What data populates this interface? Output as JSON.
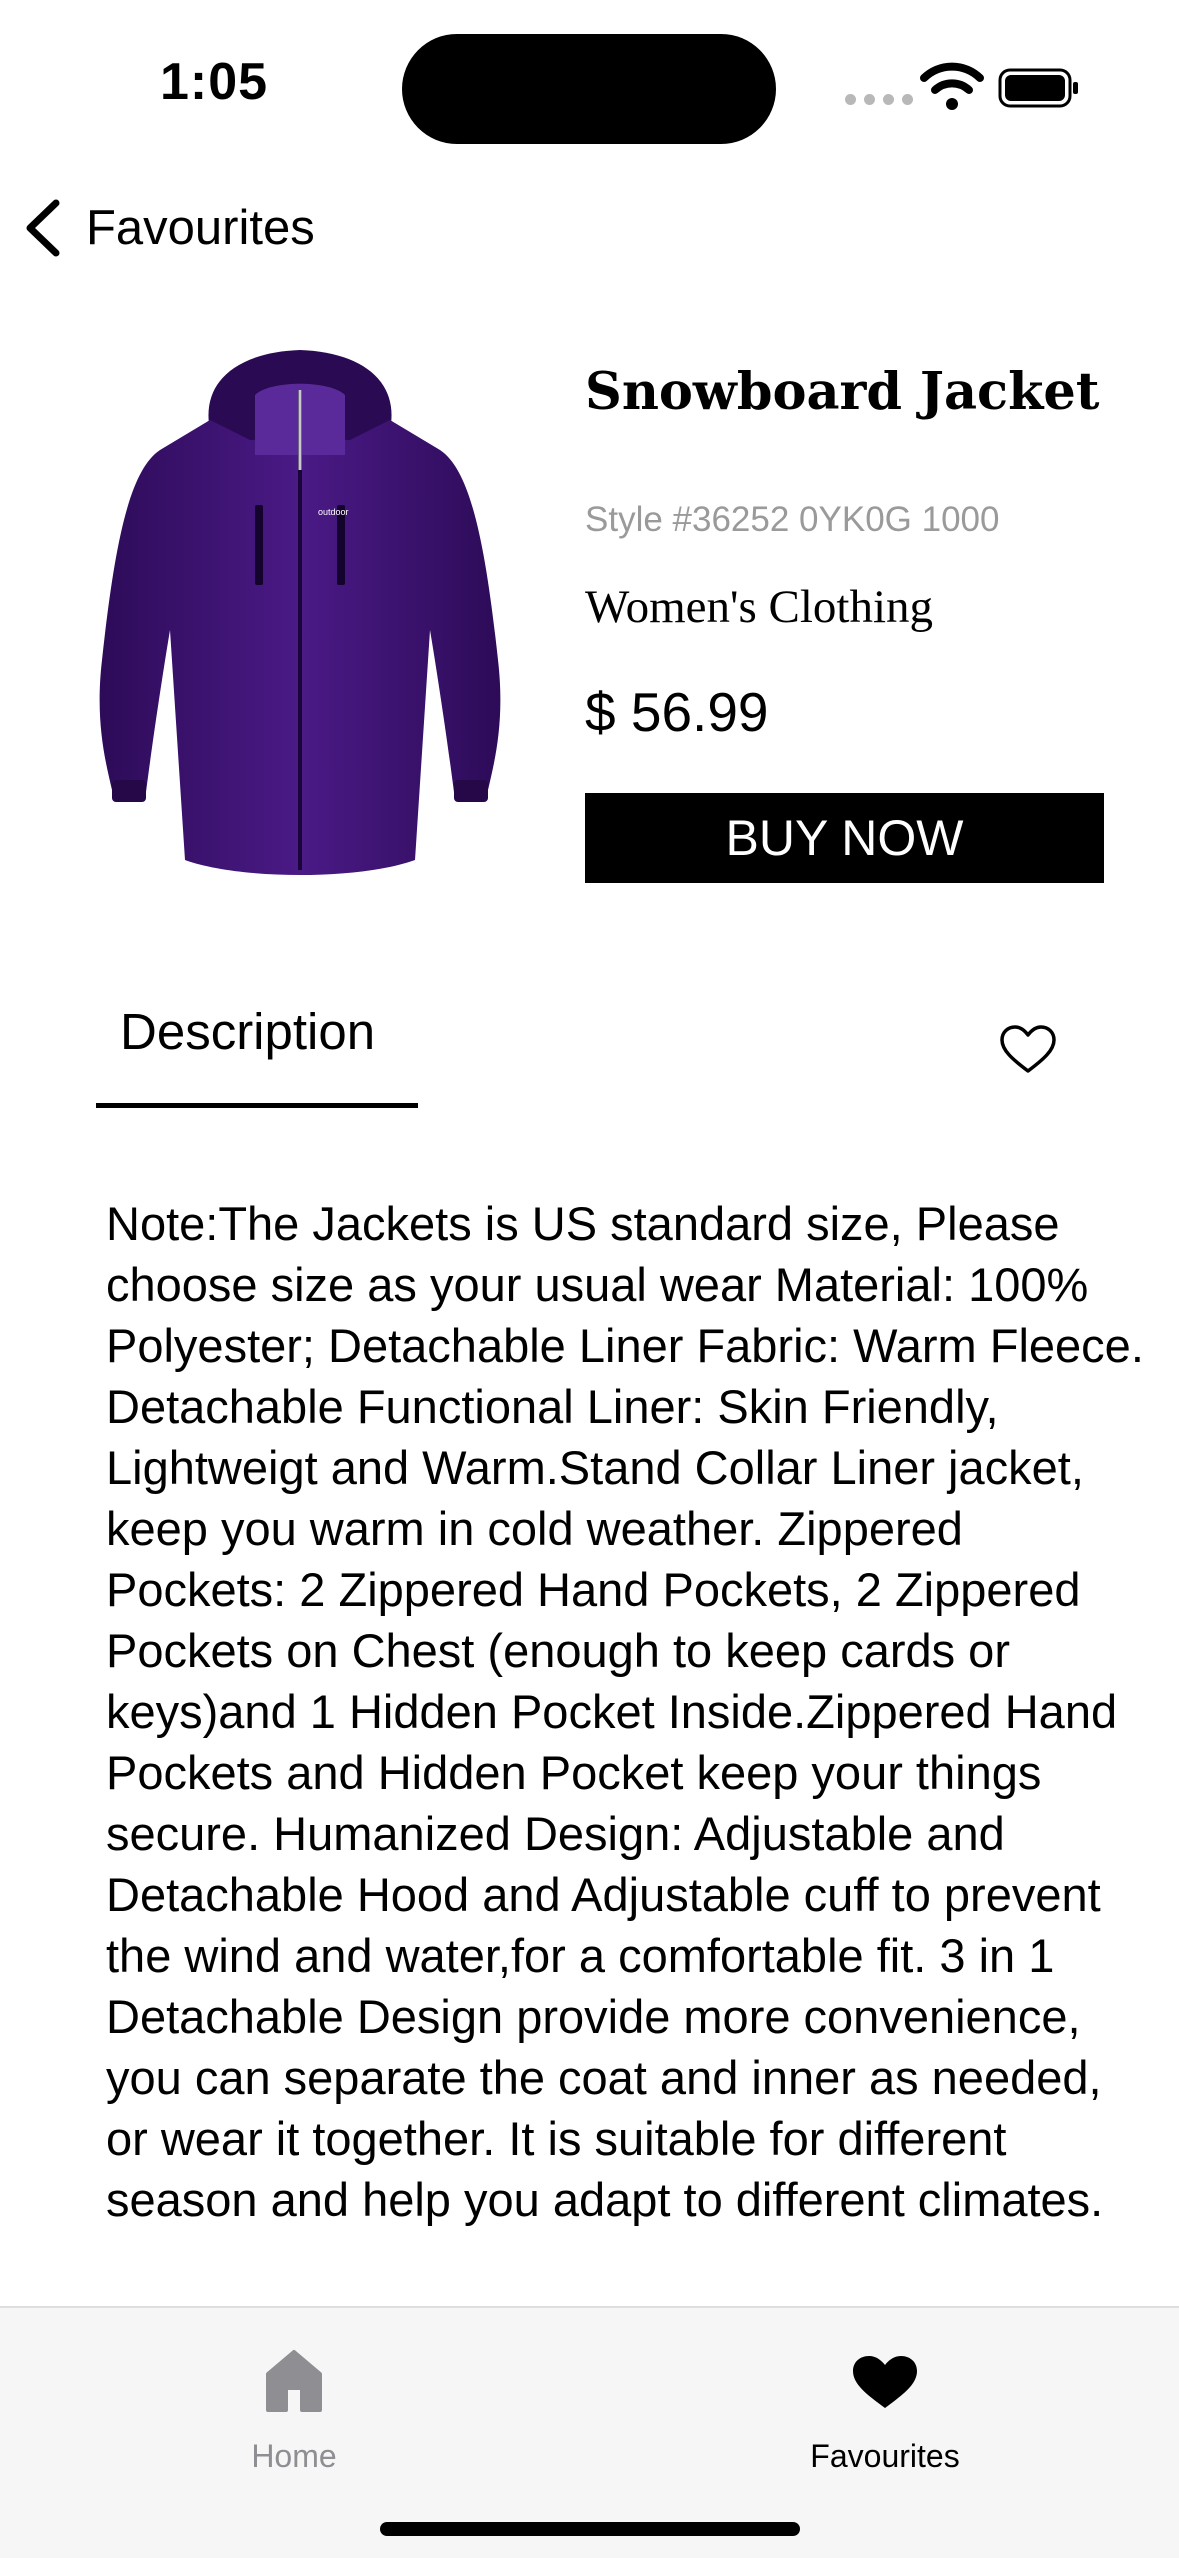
{
  "status_bar": {
    "time": "1:05"
  },
  "nav": {
    "back_label": "Favourites"
  },
  "product": {
    "title": "Snowboard Jacket",
    "style": "Style #36252 0YK0G 1000",
    "category": "Women's Clothing",
    "price": "$ 56.99",
    "buy_label": "BUY NOW",
    "image_brand": "outdoor"
  },
  "tabs": {
    "description_label": "Description"
  },
  "description": "Note:The Jackets is US standard size, Please choose size as your usual wear Material: 100% Polyester; Detachable Liner Fabric: Warm Fleece. Detachable Functional Liner: Skin Friendly, Lightweigt and Warm.Stand Collar Liner jacket, keep you warm in cold weather. Zippered Pockets: 2 Zippered Hand Pockets, 2 Zippered Pockets on Chest (enough to keep cards or keys)and 1 Hidden Pocket Inside.Zippered Hand Pockets and Hidden Pocket keep your things secure. Humanized Design: Adjustable and Detachable Hood and Adjustable cuff to prevent the wind and water,for a comfortable fit. 3 in 1 Detachable Design provide more convenience, you can separate the coat and inner as needed, or wear it together. It is suitable for different season and help you adapt to different climates.",
  "tab_bar": {
    "home_label": "Home",
    "favourites_label": "Favourites",
    "active": "favourites"
  },
  "colors": {
    "jacket": "#3b1170",
    "inactive_tab": "#8e8e93",
    "muted_text": "#9a9a9a",
    "tab_bar_bg": "#f6f6f6"
  },
  "icons": {
    "back": "chevron-left-icon",
    "wishlist": "heart-outline-icon",
    "home": "house-icon",
    "favourites": "heart-filled-icon"
  }
}
